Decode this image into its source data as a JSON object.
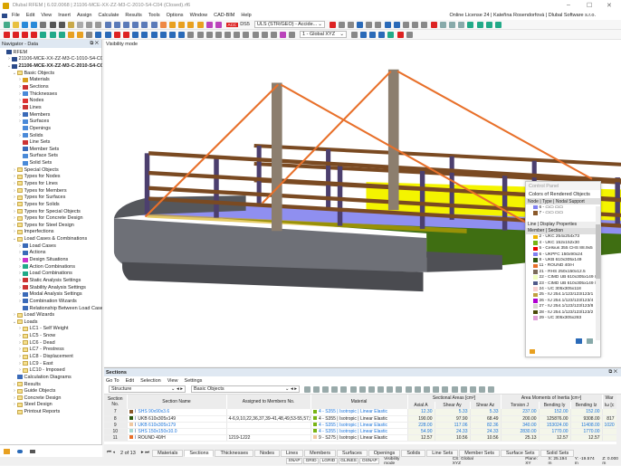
{
  "window": {
    "title": "Dlubal RFEM | 6.02.0068 | 21106-MCE-XX-ZZ-M3-C-2010-S4-C04 (Closed).rf6",
    "min": "–",
    "max": "☐",
    "close": "✕"
  },
  "menu": [
    "File",
    "Edit",
    "View",
    "Insert",
    "Assign",
    "Calculate",
    "Results",
    "Tools",
    "Options",
    "Window",
    "CAD-BIM",
    "Help"
  ],
  "license": "Online License 24 | Kateřina Rosendorfová | Dlubal Software s.r.o.",
  "toolbar1": {
    "badge": "ACC",
    "ds": "DS5",
    "combo": "ULS (STR/GEO) - Accide...",
    "icons": [
      [
        "new-icon",
        "#4a8"
      ],
      [
        "open-icon",
        "#e8c040"
      ],
      [
        "cloud-icon",
        "#2a8ad8"
      ],
      [
        "cloud-sync-icon",
        "#2a8ad8"
      ],
      [
        "block-icon",
        "#777"
      ],
      [
        "save-icon",
        "#555"
      ],
      [
        "print-icon",
        "#555"
      ],
      [
        "report-icon",
        "#c9a94a"
      ],
      [
        "page-icon",
        "#aaa"
      ],
      [
        "undo-icon",
        "#999"
      ],
      [
        "redo-icon",
        "#999"
      ],
      [
        "view1-icon",
        "#5a7ab8"
      ],
      [
        "view2-icon",
        "#5a7ab8"
      ],
      [
        "view3-icon",
        "#5a7ab8"
      ],
      [
        "view4-icon",
        "#5a7ab8"
      ],
      [
        "view5-icon",
        "#5a7ab8"
      ],
      [
        "view6-icon",
        "#5a7ab8"
      ],
      [
        "model-icon",
        "#e84"
      ],
      [
        "calc-icon",
        "#e8a020"
      ],
      [
        "calc2-icon",
        "#e8a020"
      ],
      [
        "calc3-icon",
        "#e8a020"
      ],
      [
        "calc4-icon",
        "#e8a020"
      ],
      [
        "result-icon",
        "#b4b"
      ],
      [
        "result2-icon",
        "#b4b"
      ]
    ],
    "icons2": [
      [
        "filter-icon",
        "#d22"
      ],
      [
        "support-icon",
        "#888"
      ],
      [
        "load-icon",
        "#888"
      ],
      [
        "load2-icon",
        "#2a6ab8"
      ],
      [
        "load3-icon",
        "#888"
      ],
      [
        "table-icon",
        "#888"
      ],
      [
        "table2-icon",
        "#2a6ab8"
      ],
      [
        "member-icon",
        "#2a6ab8"
      ],
      [
        "line-icon",
        "#888"
      ],
      [
        "section-icon",
        "#888"
      ],
      [
        "sect2-icon",
        "#888"
      ],
      [
        "zoom-icon",
        "#d22"
      ],
      [
        "box-icon",
        "#8aa"
      ],
      [
        "box2-icon",
        "#8aa"
      ],
      [
        "box3-icon",
        "#8aa"
      ],
      [
        "axes-icon",
        "#2a8"
      ],
      [
        "axes2-icon",
        "#2a8"
      ],
      [
        "axes3-icon",
        "#2a8"
      ],
      [
        "axes4-icon",
        "#2a8"
      ]
    ]
  },
  "toolbar2": {
    "combo": "1 - Global XYZ",
    "icons": [
      [
        "node-icon",
        "#d22"
      ],
      [
        "line-icon",
        "#d22"
      ],
      [
        "member-icon",
        "#d22"
      ],
      [
        "support-icon",
        "#d22"
      ],
      [
        "load-icon",
        "#2a8"
      ],
      [
        "load2-icon",
        "#2a8"
      ],
      [
        "load3-icon",
        "#2a8"
      ],
      [
        "dim-icon",
        "#e8a020"
      ],
      [
        "dim2-icon",
        "#e8a020"
      ],
      [
        "dim3-icon",
        "#888"
      ],
      [
        "snap-icon",
        "#2a6ab8"
      ],
      [
        "snap2-icon",
        "#2a6ab8"
      ],
      [
        "grid-icon",
        "#d22"
      ],
      [
        "grid2-icon",
        "#d22"
      ],
      [
        "grid3-icon",
        "#2a6ab8"
      ],
      [
        "select-icon",
        "#2a6ab8"
      ],
      [
        "select2-icon",
        "#2a6ab8"
      ],
      [
        "select3-icon",
        "#2a6ab8"
      ],
      [
        "select4-icon",
        "#2a6ab8"
      ],
      [
        "select5-icon",
        "#2a6ab8"
      ]
    ],
    "icons2": [
      [
        "cut-icon",
        "#888"
      ],
      [
        "cut2-icon",
        "#888"
      ],
      [
        "cut3-icon",
        "#888"
      ],
      [
        "cut4-icon",
        "#888"
      ],
      [
        "cut5-icon",
        "#888"
      ],
      [
        "line-a-icon",
        "#888"
      ],
      [
        "line-b-icon",
        "#888"
      ],
      [
        "line-c-icon",
        "#888"
      ],
      [
        "line-d-icon",
        "#888"
      ],
      [
        "line-e-icon",
        "#888"
      ],
      [
        "line-f-icon",
        "#b4b"
      ],
      [
        "measure-icon",
        "#888"
      ]
    ],
    "icons3": [
      [
        "render-icon",
        "#888"
      ],
      [
        "render2-icon",
        "#2a6ab8"
      ],
      [
        "render3-icon",
        "#2a6ab8"
      ],
      [
        "render4-icon",
        "#2a6ab8"
      ],
      [
        "display-icon",
        "#2a8"
      ],
      [
        "guide-icon",
        "#d22"
      ],
      [
        "transparent-icon",
        "#888"
      ]
    ]
  },
  "navigator": {
    "title": "Navigator - Data",
    "tree": [
      [
        0,
        "",
        "RFEM",
        "rfem"
      ],
      [
        1,
        ">",
        "21106-MCE-XX-ZZ-M3-C-1010-S4-C04 (Open",
        "model"
      ],
      [
        1,
        "v",
        "21106-MCE-XX-ZZ-M3-C-2010-S4-C04 (Closed)",
        "model"
      ],
      [
        2,
        "v",
        "Basic Objects",
        "folder"
      ],
      [
        3,
        ">",
        "Materials",
        "#d8a020"
      ],
      [
        3,
        ">",
        "Sections",
        "#c33"
      ],
      [
        3,
        ">",
        "Thicknesses",
        "#4a8ad8"
      ],
      [
        3,
        ">",
        "Nodes",
        "#d33"
      ],
      [
        3,
        ">",
        "Lines",
        "#c33"
      ],
      [
        3,
        ">",
        "Members",
        "#3a6ab8"
      ],
      [
        3,
        ">",
        "Surfaces",
        "#4a8ad8"
      ],
      [
        3,
        "",
        "Openings",
        "#4a8ad8"
      ],
      [
        3,
        ">",
        "Solids",
        "#4a8ad8"
      ],
      [
        3,
        "",
        "Line Sets",
        "#c33"
      ],
      [
        3,
        "",
        "Member Sets",
        "#3a6ab8"
      ],
      [
        3,
        "",
        "Surface Sets",
        "#4a8ad8"
      ],
      [
        3,
        "",
        "Solid Sets",
        "#4a8ad8"
      ],
      [
        2,
        ">",
        "Special Objects",
        "folder"
      ],
      [
        2,
        ">",
        "Types for Nodes",
        "folder"
      ],
      [
        2,
        ">",
        "Types for Lines",
        "folder"
      ],
      [
        2,
        ">",
        "Types for Members",
        "folder"
      ],
      [
        2,
        ">",
        "Types for Surfaces",
        "folder"
      ],
      [
        2,
        ">",
        "Types for Solids",
        "folder"
      ],
      [
        2,
        ">",
        "Types for Special Objects",
        "folder"
      ],
      [
        2,
        ">",
        "Types for Concrete Design",
        "folder"
      ],
      [
        2,
        ">",
        "Types for Steel Design",
        "folder"
      ],
      [
        2,
        ">",
        "Imperfections",
        "folder"
      ],
      [
        2,
        "v",
        "Load Cases & Combinations",
        "folder"
      ],
      [
        3,
        ">",
        "Load Cases",
        "#3a6ab8"
      ],
      [
        3,
        ">",
        "Actions",
        "#3a6ab8"
      ],
      [
        3,
        ">",
        "Design Situations",
        "#c3c"
      ],
      [
        3,
        ">",
        "Action Combinations",
        "#2a8"
      ],
      [
        3,
        ">",
        "Load Combinations",
        "#2a8"
      ],
      [
        3,
        ">",
        "Static Analysis Settings",
        "#c33"
      ],
      [
        3,
        ">",
        "Stability Analysis Settings",
        "#c33"
      ],
      [
        3,
        ">",
        "Modal Analysis Settings",
        "#3a6ab8"
      ],
      [
        3,
        ">",
        "Combination Wizards",
        "#3a6ab8"
      ],
      [
        3,
        "",
        "Relationship Between Load Cases",
        "#3a6ab8"
      ],
      [
        2,
        ">",
        "Load Wizards",
        "folder"
      ],
      [
        2,
        "v",
        "Loads",
        "folder"
      ],
      [
        3,
        ">",
        "LC1 - Self Weight",
        "folder"
      ],
      [
        3,
        ">",
        "LC5 - Snow",
        "folder"
      ],
      [
        3,
        ">",
        "LC6 - Dead",
        "folder"
      ],
      [
        3,
        ">",
        "LC7 - Prestress",
        "folder"
      ],
      [
        3,
        ">",
        "LC8 - Displacement",
        "folder"
      ],
      [
        3,
        ">",
        "LC9 - East",
        "folder"
      ],
      [
        3,
        ">",
        "LC10 - Imposed",
        "folder"
      ],
      [
        2,
        "",
        "Calculation Diagrams",
        "#3a6ab8"
      ],
      [
        2,
        ">",
        "Results",
        "folder"
      ],
      [
        2,
        ">",
        "Guide Objects",
        "folder"
      ],
      [
        2,
        ">",
        "Concrete Design",
        "folder"
      ],
      [
        2,
        ">",
        "Steel Design",
        "folder"
      ],
      [
        2,
        "",
        "Printout Reports",
        "folder"
      ]
    ]
  },
  "viewport": {
    "mode_label": "Visibility mode"
  },
  "control_panel": {
    "title": "Control Panel",
    "subtitle": "Colors of Rendered Objects",
    "group1": "Node | Type | Nodal Support",
    "nodes": [
      {
        "label": "6 - ▭▭ ▭▭",
        "color": "#8080f0"
      },
      {
        "label": "7 - ▭▭ ▭▭",
        "color": "#8b5a2b"
      }
    ],
    "group2": "Line | Display Properties",
    "group3": "Member | Section",
    "members": [
      {
        "label": "2 - UKC 254x254x73",
        "color": "#f0b400"
      },
      {
        "label": "4 - UKC 152x152x30",
        "color": "#78b414"
      },
      {
        "label": "5 - Celsius 355 CHS 88.9x5",
        "color": "#f00000"
      },
      {
        "label": "6 - UKPFC 150x90x24",
        "color": "#8080f0"
      },
      {
        "label": "8 - UKB 610x305x149",
        "color": "#2d5a0f"
      },
      {
        "label": "11 - ROUND 40/H",
        "color": "#e8702a"
      },
      {
        "label": "21 - RHS 250x150x12.5",
        "color": "#7a6a5a"
      },
      {
        "label": "22 - CIMD UB 610x305x149 /",
        "color": "#f0ffc0"
      },
      {
        "label": "23 - CIMD UB 610x305x149 /",
        "color": "#505a8a"
      },
      {
        "label": "24 - UC 305x305x118",
        "color": "#f8d0d0"
      },
      {
        "label": "25 - IU 254.1/123/123/123/1",
        "color": "#c0a040"
      },
      {
        "label": "26 - IU 254.1/123/123/123/4",
        "color": "#b000d0"
      },
      {
        "label": "27 - IU 254.1/123/123/123/8",
        "color": "#d8d8d0"
      },
      {
        "label": "28 - IU 254.1/123/123/123/2",
        "color": "#4a4a08"
      },
      {
        "label": "29 - UC 305x305x283",
        "color": "#e0a0d8"
      }
    ]
  },
  "sections": {
    "title": "Sections",
    "menu": [
      "Go To",
      "Edit",
      "Selection",
      "View",
      "Settings"
    ],
    "combo1": "Structure",
    "combo2": "Basic Objects",
    "headers": {
      "no": "Section No.",
      "name": "Section Name",
      "assigned": "Assigned to Members No.",
      "material": "Material",
      "areas": "Sectional Areas [cm²]",
      "axial": "Axial A",
      "shear_y": "Shear Ay",
      "shear_z": "Shear Az",
      "inertia": "Area Moments of Inertia [cm⁴]",
      "torsion": "Torsion J",
      "bend_y": "Bending Iy",
      "bend_z": "Bending Iz",
      "warp": "War",
      "warp2": "Iω [c"
    },
    "rows": [
      {
        "no": "7",
        "name": "SHS 90x90x3.6",
        "color": "#8b5a2b",
        "link": true,
        "assigned": "",
        "material": "4 - S355 | Isotropic | Linear Elastic",
        "mat_color": "#78b414",
        "A": "12.30",
        "Ay": "5.33",
        "Az": "5.33",
        "J": "237.00",
        "Iy": "152.00",
        "Iz": "152.00",
        "Iw": ""
      },
      {
        "no": "8",
        "name": "UKB 610x305x149",
        "color": "#2d5a0f",
        "link": false,
        "assigned": "4-6,9,10,22,36,37,39-41,48,49,53-55,57,5...",
        "material": "4 - S355 | Isotropic | Linear Elastic",
        "mat_color": "#78b414",
        "A": "190.00",
        "Ay": "97.90",
        "Az": "68.49",
        "J": "200.00",
        "Iy": "125876.00",
        "Iz": "9308.00",
        "Iw": "817"
      },
      {
        "no": "9",
        "name": "UKB 610x305x179",
        "color": "#f0c8a0",
        "link": true,
        "assigned": "",
        "material": "4 - S355 | Isotropic | Linear Elastic",
        "mat_color": "#78b414",
        "A": "228.00",
        "Ay": "117.06",
        "Az": "82.36",
        "J": "340.00",
        "Iy": "153024.00",
        "Iz": "11408.00",
        "Iw": "1020"
      },
      {
        "no": "10",
        "name": "SHS 150x150x10.0",
        "color": "#a8d8d0",
        "link": true,
        "assigned": "",
        "material": "4 - S355 | Isotropic | Linear Elastic",
        "mat_color": "#78b414",
        "A": "54.90",
        "Ay": "24.33",
        "Az": "24.33",
        "J": "2830.00",
        "Iy": "1770.00",
        "Iz": "1770.00",
        "Iw": ""
      },
      {
        "no": "11",
        "name": "ROUND 40/H",
        "color": "#e8702a",
        "link": false,
        "assigned": "1219-1222",
        "material": "9 - S275 | Isotropic | Linear Elastic",
        "mat_color": "#f0c8a0",
        "A": "12.57",
        "Ay": "10.56",
        "Az": "10.56",
        "J": "25.13",
        "Iy": "12.57",
        "Iz": "12.57",
        "Iw": ""
      }
    ],
    "pager": "2 of 13",
    "tabs": [
      "Materials",
      "Sections",
      "Thicknesses",
      "Nodes",
      "Lines",
      "Members",
      "Surfaces",
      "Openings",
      "Solids",
      "Line Sets",
      "Member Sets",
      "Surface Sets",
      "Solid Sets"
    ],
    "active_tab": 1
  },
  "status": {
    "buttons": [
      "SNAP",
      "GRID",
      "LGRID",
      "GLINES",
      "OSNAP"
    ],
    "mode": "Visibility mode",
    "cs": "CS: Global XYZ",
    "plane": "Plane: XY",
    "x": "X: 25.194 m",
    "y": "Y: -19.574 m",
    "z": "Z: 0.000 m"
  }
}
